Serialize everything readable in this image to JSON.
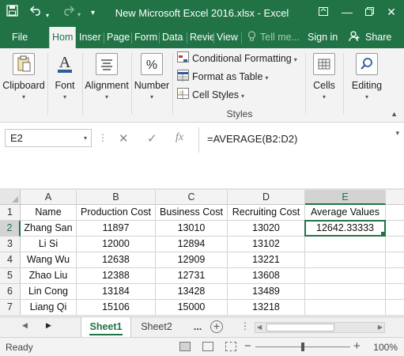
{
  "app": {
    "title": "New Microsoft Excel 2016.xlsx - Excel",
    "icons": [
      "save-icon",
      "undo-icon",
      "redo-icon",
      "customize-qat-icon",
      "ribbon-display-icon",
      "minimize-icon",
      "restore-icon",
      "close-icon"
    ],
    "accent_color": "#217346"
  },
  "tabs": {
    "file": "File",
    "home": "Hom",
    "insert": "Inser",
    "page": "Page",
    "formulas": "Form",
    "data": "Data",
    "review": "Revie",
    "view": "View",
    "tell_me": "Tell me...",
    "sign_in": "Sign in",
    "share": "Share"
  },
  "ribbon": {
    "clipboard": "Clipboard",
    "font": "Font",
    "alignment": "Alignment",
    "number": "Number",
    "conditional_formatting": "Conditional Formatting",
    "format_as_table": "Format as Table",
    "cell_styles": "Cell Styles",
    "styles_group": "Styles",
    "cells": "Cells",
    "editing": "Editing"
  },
  "formula_bar": {
    "name_box": "E2",
    "formula": "=AVERAGE(B2:D2)",
    "fx": "fx"
  },
  "sheet": {
    "columns": [
      "A",
      "B",
      "C",
      "D",
      "E"
    ],
    "selected_column": "E",
    "selected_row": "2",
    "rows": [
      {
        "num": "1",
        "cells": [
          "Name",
          "Production Cost",
          "Business Cost",
          "Recruiting Cost",
          "Average Values"
        ]
      },
      {
        "num": "2",
        "cells": [
          "Zhang San",
          "11897",
          "13010",
          "13020",
          "12642.33333"
        ]
      },
      {
        "num": "3",
        "cells": [
          "Li Si",
          "12000",
          "12894",
          "13102",
          ""
        ]
      },
      {
        "num": "4",
        "cells": [
          "Wang Wu",
          "12638",
          "12909",
          "13221",
          ""
        ]
      },
      {
        "num": "5",
        "cells": [
          "Zhao Liu",
          "12388",
          "12731",
          "13608",
          ""
        ]
      },
      {
        "num": "6",
        "cells": [
          "Lin Cong",
          "13184",
          "13428",
          "13489",
          ""
        ]
      },
      {
        "num": "7",
        "cells": [
          "Liang Qi",
          "15106",
          "15000",
          "13218",
          ""
        ]
      }
    ]
  },
  "sheet_tabs": {
    "tabs": [
      "Sheet1",
      "Sheet2"
    ],
    "active": "Sheet1",
    "more": "..."
  },
  "status": {
    "ready": "Ready",
    "zoom": "100%"
  }
}
